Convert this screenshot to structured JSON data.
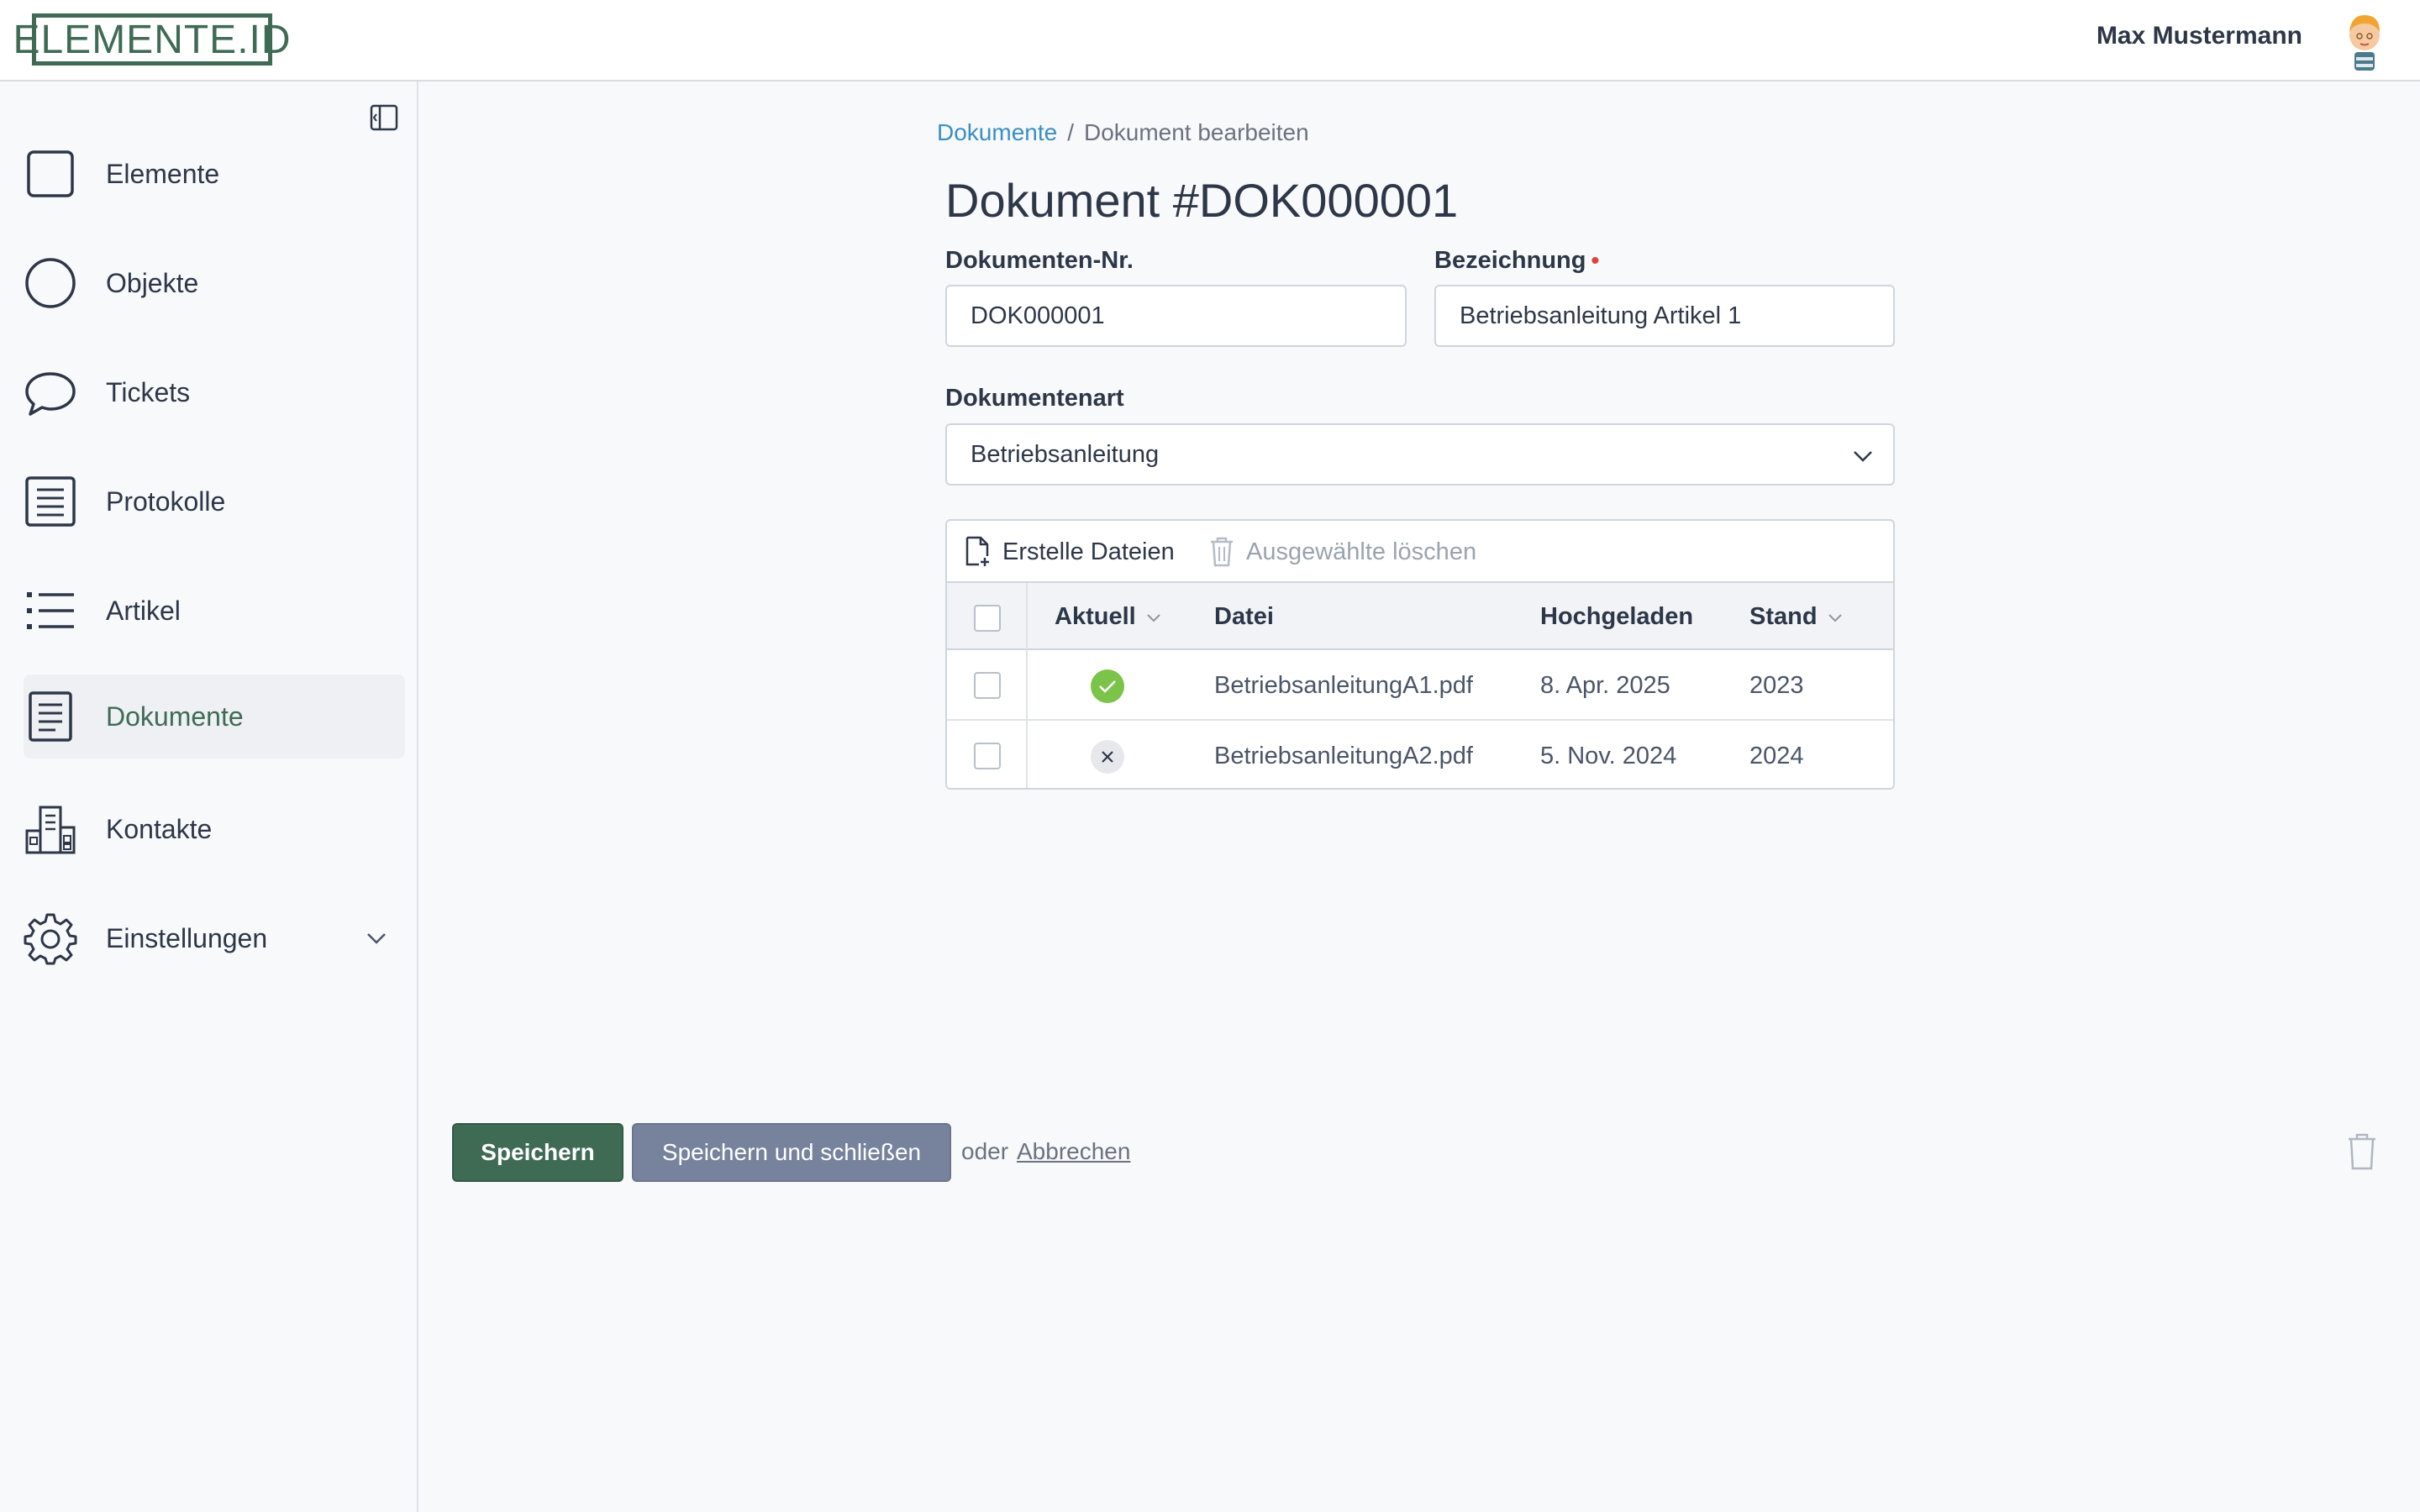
{
  "header": {
    "logo_text": "ELEMENTE.ID",
    "user_name": "Max Mustermann"
  },
  "sidebar": {
    "items": [
      {
        "label": "Elemente",
        "icon": "square-icon"
      },
      {
        "label": "Objekte",
        "icon": "circle-icon"
      },
      {
        "label": "Tickets",
        "icon": "speech-bubble-icon"
      },
      {
        "label": "Protokolle",
        "icon": "document-list-icon"
      },
      {
        "label": "Artikel",
        "icon": "list-icon"
      },
      {
        "label": "Dokumente",
        "icon": "document-icon",
        "active": true
      },
      {
        "label": "Kontakte",
        "icon": "buildings-icon"
      },
      {
        "label": "Einstellungen",
        "icon": "gear-icon",
        "expandable": true
      }
    ]
  },
  "breadcrumb": {
    "parent": "Dokumente",
    "separator": "/",
    "current": "Dokument bearbeiten"
  },
  "page": {
    "title": "Dokument #DOK000001"
  },
  "form": {
    "doc_number_label": "Dokumenten-Nr.",
    "doc_number_value": "DOK000001",
    "name_label": "Bezeichnung",
    "name_required": "•",
    "name_value": "Betriebsanleitung Artikel 1",
    "type_label": "Dokumentenart",
    "type_value": "Betriebsanleitung"
  },
  "files": {
    "toolbar": {
      "create_label": "Erstelle Dateien",
      "delete_label": "Ausgewählte löschen"
    },
    "columns": [
      "Aktuell",
      "Datei",
      "Hochgeladen",
      "Stand"
    ],
    "rows": [
      {
        "current": true,
        "file": "BetriebsanleitungA1.pdf",
        "uploaded": "8. Apr. 2025",
        "version": "2023"
      },
      {
        "current": false,
        "file": "BetriebsanleitungA2.pdf",
        "uploaded": "5. Nov. 2024",
        "version": "2024"
      }
    ]
  },
  "actions": {
    "save_label": "Speichern",
    "save_close_label": "Speichern und schließen",
    "or_text": "oder",
    "cancel_label": "Abbrechen"
  },
  "colors": {
    "brand": "#3f6b55",
    "link": "#3b8fc4",
    "secondary_button": "#77839d",
    "success": "#7cc34a",
    "required": "#e53e3e"
  }
}
